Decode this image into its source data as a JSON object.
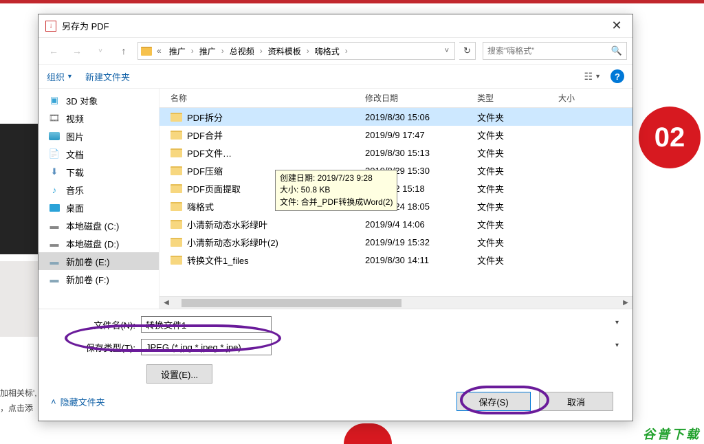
{
  "bg": {
    "badge2": "02",
    "text1": "加相关标',",
    "text2": "，点击添",
    "water": "谷普下载"
  },
  "titlebar": {
    "title": "另存为 PDF",
    "close": "✕"
  },
  "breadcrumb": {
    "more": "«",
    "parts": [
      "推广",
      "推广",
      "总视频",
      "资料模板",
      "嗨格式"
    ]
  },
  "search": {
    "placeholder": "搜索\"嗨格式\"",
    "icon": "🔍"
  },
  "toolbar": {
    "organize": "组织",
    "newfolder": "新建文件夹"
  },
  "sidebar": {
    "items": [
      {
        "label": "3D 对象"
      },
      {
        "label": "视频"
      },
      {
        "label": "图片"
      },
      {
        "label": "文档"
      },
      {
        "label": "下载"
      },
      {
        "label": "音乐"
      },
      {
        "label": "桌面"
      },
      {
        "label": "本地磁盘 (C:)"
      },
      {
        "label": "本地磁盘 (D:)"
      },
      {
        "label": "新加卷 (E:)"
      },
      {
        "label": "新加卷 (F:)"
      }
    ]
  },
  "columns": {
    "name": "名称",
    "date": "修改日期",
    "type": "类型",
    "size": "大小"
  },
  "files": [
    {
      "name": "PDF拆分",
      "date": "2019/8/30 15:06",
      "type": "文件夹",
      "selected": true
    },
    {
      "name": "PDF合并",
      "date": "2019/9/9 17:47",
      "type": "文件夹"
    },
    {
      "name": "PDF文件…",
      "date": "2019/8/30 15:13",
      "type": "文件夹"
    },
    {
      "name": "PDF压缩",
      "date": "2019/8/29 15:30",
      "type": "文件夹"
    },
    {
      "name": "PDF页面提取",
      "date": "2019/9/2 15:18",
      "type": "文件夹"
    },
    {
      "name": "嗨格式",
      "date": "2019/9/24 18:05",
      "type": "文件夹"
    },
    {
      "name": "小清新动态水彩绿叶",
      "date": "2019/9/4 14:06",
      "type": "文件夹"
    },
    {
      "name": "小清新动态水彩绿叶(2)",
      "date": "2019/9/19 15:32",
      "type": "文件夹"
    },
    {
      "name": "转换文件1_files",
      "date": "2019/8/30 14:11",
      "type": "文件夹"
    }
  ],
  "tooltip": {
    "line1": "创建日期: 2019/7/23 9:28",
    "line2": "大小: 50.8 KB",
    "line3": "文件: 合并_PDF转换成Word(2)"
  },
  "form": {
    "filename_label": "文件名(N):",
    "filename_value": "转换文件1",
    "savetype_label": "保存类型(T):",
    "savetype_value": "JPEG (*.jpg,*.jpeg,*.jpe)",
    "settings": "设置(E)...",
    "hide": "隐藏文件夹",
    "save": "保存(S)",
    "cancel": "取消"
  }
}
